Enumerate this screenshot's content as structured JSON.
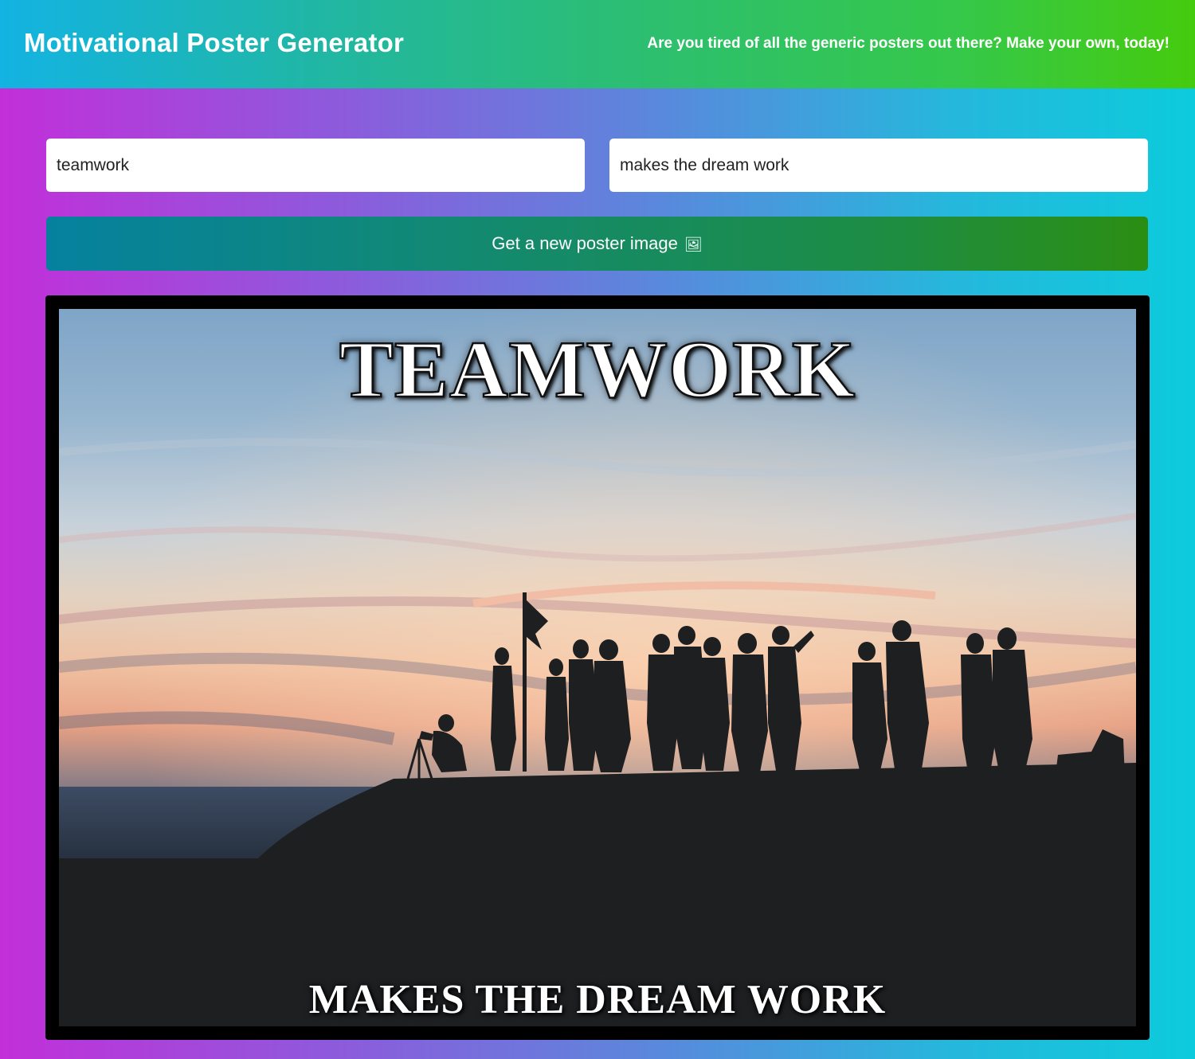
{
  "header": {
    "title": "Motivational Poster Generator",
    "tagline": "Are you tired of all the generic posters out there? Make your own, today!"
  },
  "form": {
    "top_text_value": "teamwork",
    "bottom_text_value": "makes the dream work",
    "new_image_button_label": "Get a new poster image",
    "new_image_button_icon": "picture-icon",
    "new_image_button_glyph": "🖼"
  },
  "poster": {
    "top_text": "teamwork",
    "bottom_text": "makes the dream work",
    "photo_subject": "silhouettes of a group of people with a flag on a hill by the sea at sunset"
  },
  "colors": {
    "header_gradient": [
      "#13b3e2",
      "#45cb0e"
    ],
    "page_gradient": [
      "#c22fd9",
      "#0ccbdc"
    ],
    "button_gradient": [
      "#05819f",
      "#2b8e13"
    ],
    "poster_frame": "#000000"
  }
}
